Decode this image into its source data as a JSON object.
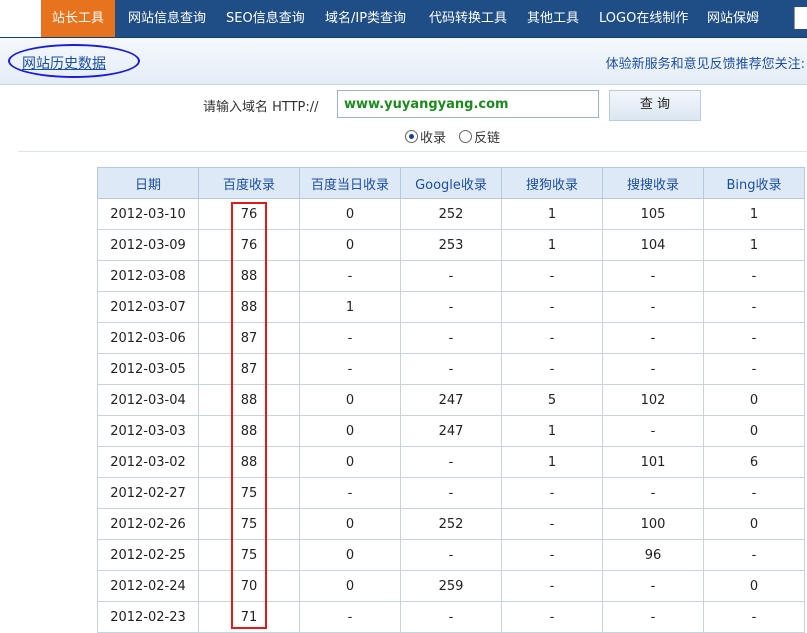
{
  "nav": {
    "items": [
      "站长工具",
      "网站信息查询",
      "SEO信息查询",
      "域名/IP类查询",
      "代码转换工具",
      "其他工具",
      "LOGO在线制作",
      "网站保姆"
    ]
  },
  "subbar": {
    "history_link": "网站历史数据",
    "right_items": [
      "体验新服务",
      "和",
      "意见反馈",
      "推荐您关注:"
    ]
  },
  "search": {
    "label": "请输入域名 HTTP://",
    "value": "www.yuyangyang.com",
    "button": "查 询",
    "options": [
      "收录",
      "反链"
    ],
    "selected_option": "收录"
  },
  "table": {
    "headers": [
      "日期",
      "百度收录",
      "百度当日收录",
      "Google收录",
      "搜狗收录",
      "搜搜收录",
      "Bing收录"
    ],
    "rows": [
      [
        "2012-03-10",
        "76",
        "0",
        "252",
        "1",
        "105",
        "1"
      ],
      [
        "2012-03-09",
        "76",
        "0",
        "253",
        "1",
        "104",
        "1"
      ],
      [
        "2012-03-08",
        "88",
        "-",
        "-",
        "-",
        "-",
        "-"
      ],
      [
        "2012-03-07",
        "88",
        "1",
        "-",
        "-",
        "-",
        "-"
      ],
      [
        "2012-03-06",
        "87",
        "-",
        "-",
        "-",
        "-",
        "-"
      ],
      [
        "2012-03-05",
        "87",
        "-",
        "-",
        "-",
        "-",
        "-"
      ],
      [
        "2012-03-04",
        "88",
        "0",
        "247",
        "5",
        "102",
        "0"
      ],
      [
        "2012-03-03",
        "88",
        "0",
        "247",
        "1",
        "-",
        "0"
      ],
      [
        "2012-03-02",
        "88",
        "0",
        "-",
        "1",
        "101",
        "6"
      ],
      [
        "2012-02-27",
        "75",
        "-",
        "-",
        "-",
        "-",
        "-"
      ],
      [
        "2012-02-26",
        "75",
        "0",
        "252",
        "-",
        "100",
        "0"
      ],
      [
        "2012-02-25",
        "75",
        "0",
        "-",
        "-",
        "96",
        "-"
      ],
      [
        "2012-02-24",
        "70",
        "0",
        "259",
        "-",
        "-",
        "0"
      ],
      [
        "2012-02-23",
        "71",
        "-",
        "-",
        "-",
        "-",
        "-"
      ]
    ]
  },
  "colors": {
    "nav_bg": "#1f4e86",
    "nav_active": "#e8731f",
    "link": "#1d4fa0",
    "ellipse": "#1c1cd6",
    "highlight_box": "#e01a1a",
    "input_text": "#1d8a1d"
  }
}
